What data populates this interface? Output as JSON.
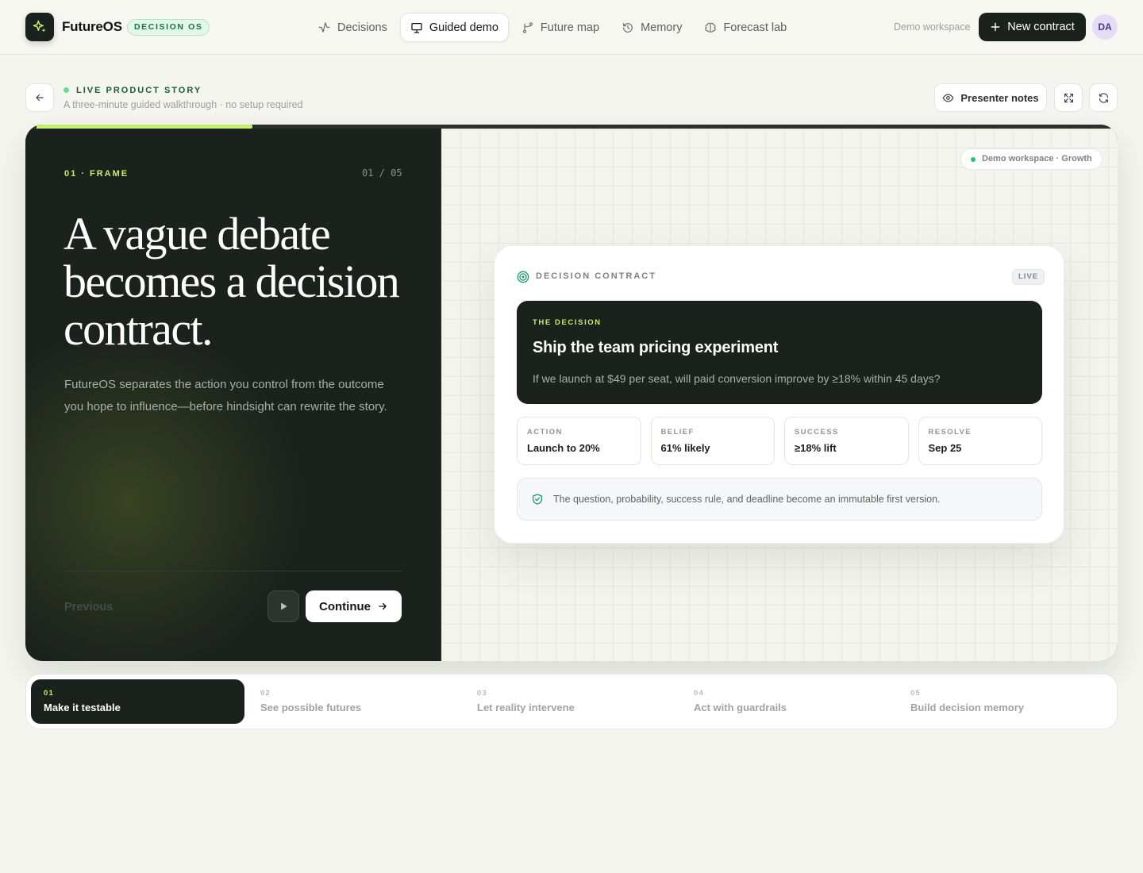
{
  "app": {
    "name": "FutureOS",
    "badge": "DECISION OS"
  },
  "nav": [
    {
      "label": "Decisions",
      "icon": "activity-icon",
      "active": false
    },
    {
      "label": "Guided demo",
      "icon": "presentation-icon",
      "active": true
    },
    {
      "label": "Future map",
      "icon": "branch-icon",
      "active": false
    },
    {
      "label": "Memory",
      "icon": "history-icon",
      "active": false
    },
    {
      "label": "Forecast lab",
      "icon": "brain-icon",
      "active": false
    }
  ],
  "header": {
    "workspace": "Demo workspace",
    "new_contract": "New contract",
    "avatar": "DA"
  },
  "story": {
    "title": "LIVE PRODUCT STORY",
    "subtitle": "A three-minute guided walkthrough · no setup required",
    "presenter_notes": "Presenter notes"
  },
  "slide": {
    "progress": 0.2,
    "tag": "01 · FRAME",
    "counter": "01 / 05",
    "headline": "A vague debate becomes a decision contract.",
    "lead": "FutureOS separates the action you control from the outcome you hope to influence—before hindsight can rewrite the story.",
    "previous": "Previous",
    "continue": "Continue"
  },
  "preview": {
    "workspace_pill": "Demo workspace · Growth",
    "card_title": "DECISION CONTRACT",
    "live": "LIVE",
    "decision_tag": "THE DECISION",
    "decision_title": "Ship the team pricing experiment",
    "decision_question": "If we launch at $49 per seat, will paid conversion improve by ≥18% within 45 days?",
    "metrics": [
      {
        "label": "ACTION",
        "value": "Launch to 20%"
      },
      {
        "label": "BELIEF",
        "value": "61% likely"
      },
      {
        "label": "SUCCESS",
        "value": "≥18% lift"
      },
      {
        "label": "RESOLVE",
        "value": "Sep 25"
      }
    ],
    "note": "The question, probability, success rule, and deadline become an immutable first version."
  },
  "steps": [
    {
      "num": "01",
      "label": "Make it testable",
      "active": true
    },
    {
      "num": "02",
      "label": "See possible futures",
      "active": false
    },
    {
      "num": "03",
      "label": "Let reality intervene",
      "active": false
    },
    {
      "num": "04",
      "label": "Act with guardrails",
      "active": false
    },
    {
      "num": "05",
      "label": "Build decision memory",
      "active": false
    }
  ]
}
